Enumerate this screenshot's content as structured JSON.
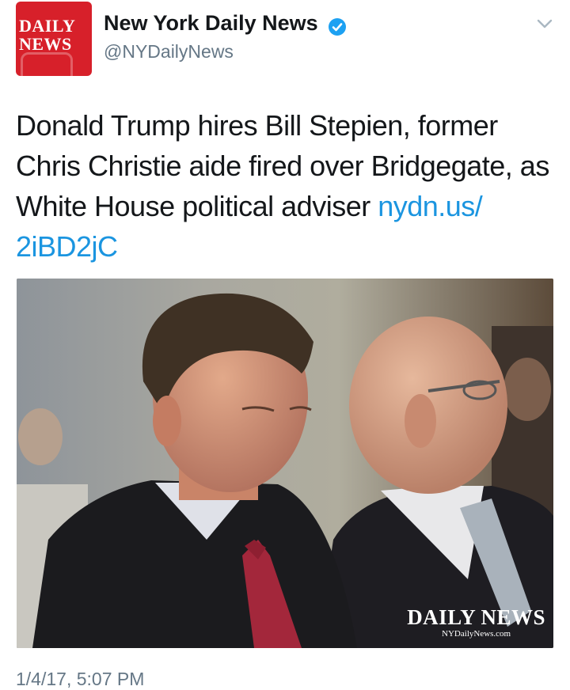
{
  "account": {
    "avatar_line1": "DAILY",
    "avatar_line2": "NEWS",
    "name": "New York Daily News",
    "handle": "@NYDailyNews",
    "verified": true
  },
  "tweet": {
    "text": "Donald Trump hires Bill Stepien, former Chris Christie aide fired over Bridgegate, as White House political adviser ",
    "link_text": "nydn.us/ 2iBD2jC",
    "timestamp": "1/4/17, 5:07 PM"
  },
  "photo": {
    "watermark_main": "DAILY NEWS",
    "watermark_sub": "NYDailyNews.com"
  },
  "icons": {
    "verified": "verified-badge-icon",
    "more": "chevron-down-icon"
  },
  "colors": {
    "brand_red": "#d7202a",
    "link_blue": "#1b95e0",
    "muted_gray": "#657786",
    "verified_blue": "#1da1f2"
  }
}
